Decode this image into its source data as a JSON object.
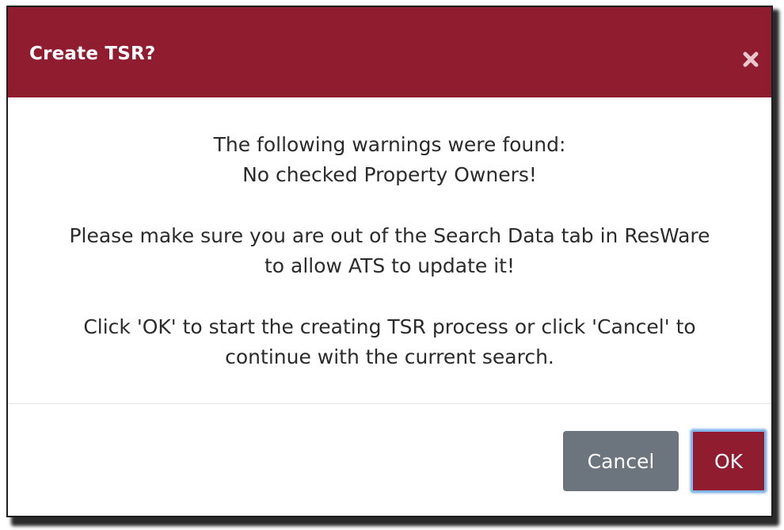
{
  "dialog": {
    "title": "Create TSR?",
    "close_icon": "close-icon",
    "header_color": "#8f1c2f",
    "body": {
      "paragraph_1": {
        "line_1": "The following warnings were found:",
        "line_2": "No checked Property Owners!"
      },
      "paragraph_2": {
        "line_1": "Please make sure you are out of the Search Data tab in ResWare",
        "line_2": "to allow ATS to update it!"
      },
      "paragraph_3": {
        "line_1": "Click 'OK' to start the creating TSR process or click 'Cancel' to",
        "line_2": "continue with the current search."
      }
    },
    "buttons": {
      "cancel_label": "Cancel",
      "ok_label": "OK"
    }
  }
}
